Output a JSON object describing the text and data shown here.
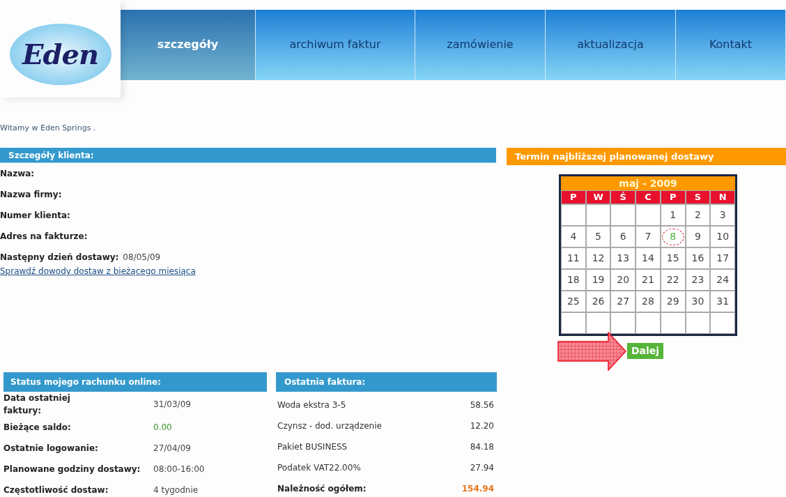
{
  "logo": {
    "text": "Eden"
  },
  "nav": [
    {
      "label": "szczegóły",
      "selected": true
    },
    {
      "label": "archiwum faktur",
      "selected": false
    },
    {
      "label": "zamówienie",
      "selected": false
    },
    {
      "label": "aktualizacja",
      "selected": false
    },
    {
      "label": "Kontakt",
      "selected": false
    }
  ],
  "welcome": "Witamy w Eden Springs .",
  "client_details": {
    "title": "Szczegóły klienta:",
    "fields": [
      {
        "label": "Nazwa:"
      },
      {
        "label": "Nazwa firmy:"
      },
      {
        "label": "Numer klienta:"
      },
      {
        "label": "Adres na fakturze:"
      },
      {
        "label": "Następny dzień dostawy:",
        "value": "08/05/09"
      }
    ],
    "link": "Sprawdź dowody dostaw z bieżącego miesiąca"
  },
  "delivery": {
    "title": "Termin najbliższej planowanej dostawy",
    "calendar": {
      "month": "maj - 2009",
      "weekdays": [
        "P",
        "W",
        "Ś",
        "C",
        "P",
        "S",
        "N"
      ],
      "weeks": [
        [
          {
            "day": "1",
            "selected": false
          },
          {
            "day": "2",
            "selected": false
          },
          {
            "day": "3",
            "selected": false
          }
        ],
        [
          {
            "day": "4",
            "selected": false
          },
          {
            "day": "5",
            "selected": false
          },
          {
            "day": "6",
            "selected": false
          },
          {
            "day": "7",
            "selected": false
          },
          {
            "day": "8",
            "selected": true
          },
          {
            "day": "9",
            "selected": false
          },
          {
            "day": "10",
            "selected": false
          }
        ],
        [
          {
            "day": "11",
            "selected": false
          },
          {
            "day": "12",
            "selected": false
          },
          {
            "day": "13",
            "selected": false
          },
          {
            "day": "14",
            "selected": false
          },
          {
            "day": "15",
            "selected": false
          },
          {
            "day": "16",
            "selected": false
          },
          {
            "day": "17",
            "selected": false
          }
        ],
        [
          {
            "day": "18",
            "selected": false
          },
          {
            "day": "19",
            "selected": false
          },
          {
            "day": "20",
            "selected": false
          },
          {
            "day": "21",
            "selected": false
          },
          {
            "day": "22",
            "selected": false
          },
          {
            "day": "23",
            "selected": false
          },
          {
            "day": "24",
            "selected": false
          }
        ],
        [
          {
            "day": "25",
            "selected": false
          },
          {
            "day": "26",
            "selected": false
          },
          {
            "day": "27",
            "selected": false
          },
          {
            "day": "28",
            "selected": false
          },
          {
            "day": "29",
            "selected": false
          },
          {
            "day": "30",
            "selected": false
          },
          {
            "day": "31",
            "selected": false
          }
        ]
      ]
    },
    "button": "Dalej"
  },
  "account_status": {
    "title": "Status mojego rachunku online:",
    "rows": [
      {
        "label": "Data ostatniej faktury:",
        "value": "31/03/09",
        "kind": "text"
      },
      {
        "label": "Bieżące saldo:",
        "value": "0.00",
        "kind": "amount"
      },
      {
        "label": "Ostatnie logowanie:",
        "value": "27/04/09",
        "kind": "text"
      },
      {
        "label": "Planowane godziny dostawy:",
        "value": "08:00-16:00",
        "kind": "text"
      },
      {
        "label": "Częstotliwość dostaw:",
        "value": "4 tygodnie",
        "kind": "text"
      }
    ]
  },
  "last_invoice": {
    "title": "Ostatnia faktura:",
    "rows": [
      {
        "label": "Woda ekstra 3-5",
        "value": "58.56",
        "kind": "item"
      },
      {
        "label": "Czynsz - dod. urządzenie",
        "value": "12.20",
        "kind": "item"
      },
      {
        "label": "Pakiet BUSINESS",
        "value": "84.18",
        "kind": "item"
      },
      {
        "label": "Podatek VAT22.00%",
        "value": "27.94",
        "kind": "item"
      },
      {
        "label": "Należność ogółem:",
        "value": "154.94",
        "kind": "total"
      }
    ]
  }
}
